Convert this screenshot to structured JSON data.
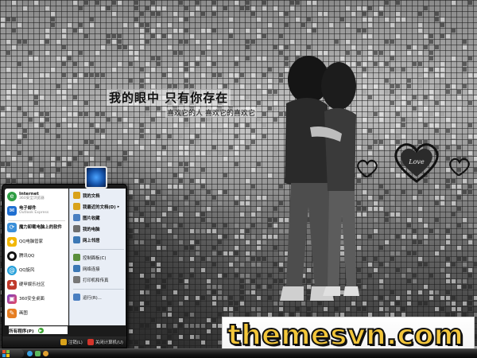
{
  "wallpaper": {
    "caption_main": "我的眼中  只有你存在",
    "caption_sub": "喜欢它的人  喜欢它的喜欢它"
  },
  "watermark": {
    "text": "themesvn.com"
  },
  "start_menu": {
    "pinned": [
      {
        "title": "Internet",
        "subtitle": "360安全浏览器",
        "icon": "internet-browser-icon",
        "color": "#2f9e44"
      },
      {
        "title": "电子邮件",
        "subtitle": "Outlook Express",
        "icon": "email-icon",
        "color": "#1f6fd1"
      }
    ],
    "recent": [
      {
        "label": "魔力卸载电脑上的软件",
        "icon": "uninstall-icon",
        "color": "#3a8fd9"
      },
      {
        "label": "QQ电脑管家",
        "icon": "qq-manager-icon",
        "color": "#f2b705"
      },
      {
        "label": "腾讯QQ",
        "icon": "qq-penguin-icon",
        "color": "#111111"
      },
      {
        "label": "QQ旋风",
        "icon": "qq-whirlwind-icon",
        "color": "#26a0da"
      },
      {
        "label": "硬甲娱乐社区",
        "icon": "game-community-icon",
        "color": "#c0392b"
      },
      {
        "label": "360安全桌面",
        "icon": "360-desktop-icon",
        "color": "#7a3fc7"
      },
      {
        "label": "画图",
        "icon": "paint-icon",
        "color": "#e67e22"
      }
    ],
    "all_programs": "所有程序(P)",
    "places": [
      {
        "label": "我的文档",
        "icon": "my-documents-icon",
        "color": "#d9a21b"
      },
      {
        "label": "我最近的文档(D)",
        "icon": "recent-documents-icon",
        "color": "#d9a21b",
        "submenu": true
      },
      {
        "label": "图片收藏",
        "icon": "my-pictures-icon",
        "color": "#4a7fc1"
      },
      {
        "label": "我的电脑",
        "icon": "my-computer-icon",
        "color": "#6e6e6e"
      },
      {
        "label": "网上邻居",
        "icon": "network-places-icon",
        "color": "#3c78b5"
      },
      {
        "label": "控制面板(C)",
        "icon": "control-panel-icon",
        "color": "#5a8f3c"
      },
      {
        "label": "网络连接",
        "icon": "network-connections-icon",
        "color": "#3c78b5"
      },
      {
        "label": "打印机和传真",
        "icon": "printer-icon",
        "color": "#777777"
      },
      {
        "label": "运行(R)...",
        "icon": "run-icon",
        "color": "#4a7fc1"
      }
    ],
    "footer": {
      "logoff": "注销(L)",
      "shutdown": "关闭计算机(U)"
    }
  }
}
